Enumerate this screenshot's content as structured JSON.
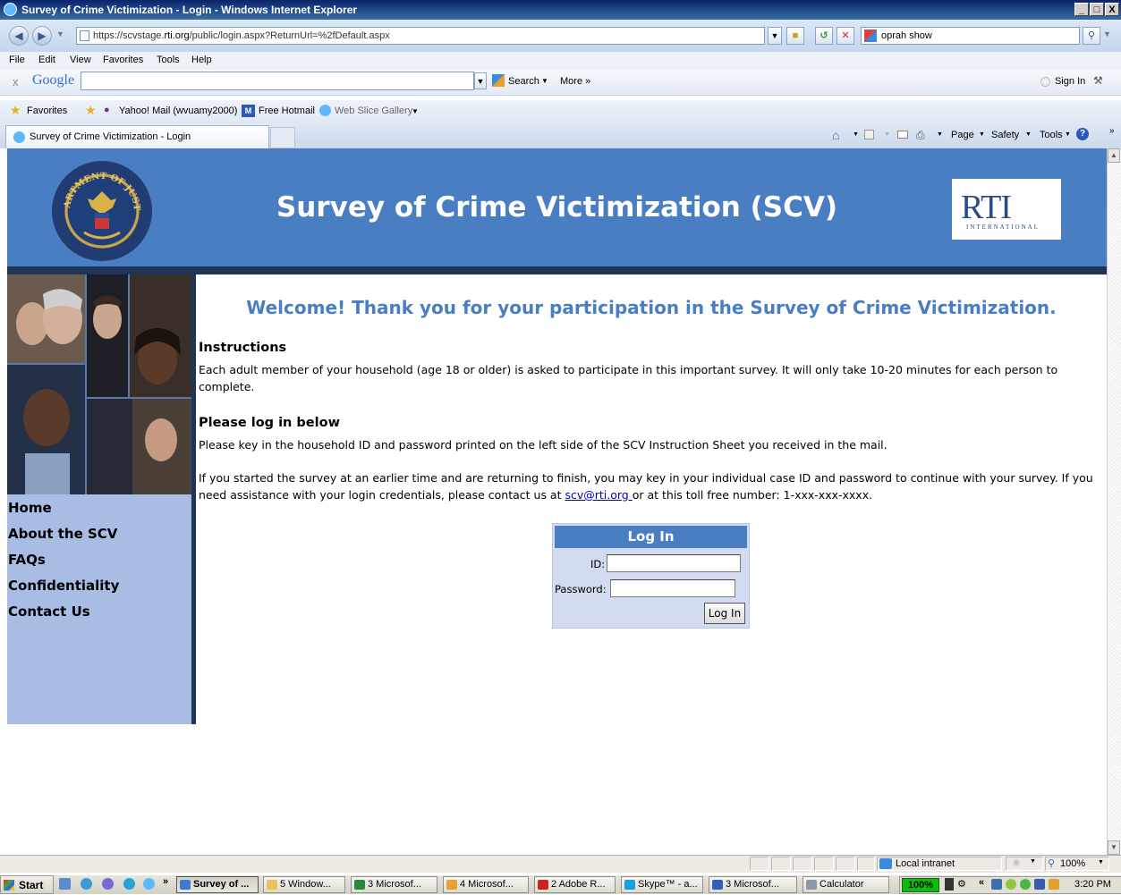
{
  "window": {
    "title": "Survey of Crime Victimization - Login - Windows Internet Explorer",
    "controls": [
      "_",
      "□",
      "X"
    ]
  },
  "browser": {
    "url_prefix": "https://scvstage.",
    "url_domain": "rti.org",
    "url_rest": "/public/login.aspx?ReturnUrl=%2fDefault.aspx",
    "search_value": "oprah show",
    "menu": [
      "File",
      "Edit",
      "View",
      "Favorites",
      "Tools",
      "Help"
    ],
    "google": {
      "close": "x",
      "logo": "Google",
      "search": "Search",
      "more": "More »",
      "signin": "Sign In"
    },
    "favorites": {
      "label": "Favorites",
      "items": [
        "Yahoo! Mail (wvuamy2000)",
        "Free Hotmail",
        "Web Slice Gallery"
      ]
    },
    "tab": {
      "title": "Survey of Crime Victimization - Login"
    },
    "command_bar": {
      "page": "Page",
      "safety": "Safety",
      "tools": "Tools"
    }
  },
  "site": {
    "title": "Survey of Crime Victimization (SCV)",
    "seal_text": "DEPARTMENT OF JUSTICE",
    "logo_main": "RTI",
    "logo_sub": "INTERNATIONAL",
    "nav": [
      "Home",
      "About the SCV",
      "FAQs",
      "Confidentiality",
      "Contact Us"
    ],
    "welcome": "Welcome! Thank you for your participation in the Survey of Crime Victimization.",
    "instructions_heading": "Instructions",
    "instructions_text": "Each adult member of your household (age 18 or older) is asked to participate in this important survey. It will only take 10-20 minutes for each person to complete.",
    "login_heading": "Please log in below",
    "login_text1": "Please key in the household ID and password printed on the left side of the SCV Instruction Sheet you received in the mail.",
    "login_text2_a": "If you started the survey at an earlier time and are returning to finish, you may key in your individual case ID and password to continue with your survey. If you need assistance with your login credentials, please contact us at ",
    "login_text2_email": "scv@rti.org ",
    "login_text2_b": "or at this toll free number: 1-xxx-xxx-xxxx.",
    "login_box": {
      "title": "Log In",
      "id_label": "ID:",
      "id_value": "",
      "password_label": "Password:",
      "password_value": "",
      "button": "Log In"
    }
  },
  "status": {
    "zone": "Local intranet",
    "zoom": "100%"
  },
  "taskbar": {
    "start": "Start",
    "buttons": [
      {
        "label": "Survey of ...",
        "active": true,
        "color": "#3a7bd5"
      },
      {
        "label": "5 Window...",
        "active": false,
        "color": "#e8c15a"
      },
      {
        "label": "3 Microsof...",
        "active": false,
        "color": "#2a8a3a"
      },
      {
        "label": "4 Microsof...",
        "active": false,
        "color": "#e8a030"
      },
      {
        "label": "2 Adobe R...",
        "active": false,
        "color": "#d02020"
      },
      {
        "label": "Skype™ - a...",
        "active": false,
        "color": "#1a9fe0"
      },
      {
        "label": "3 Microsof...",
        "active": false,
        "color": "#3060c0"
      },
      {
        "label": "Calculator",
        "active": false,
        "color": "#8899aa"
      }
    ],
    "cpu": "100%",
    "time": "3:20 PM"
  },
  "colors": {
    "header_blue": "#4a7ec2",
    "sidebar": "#a9bce3",
    "navy": "#1f3558"
  }
}
